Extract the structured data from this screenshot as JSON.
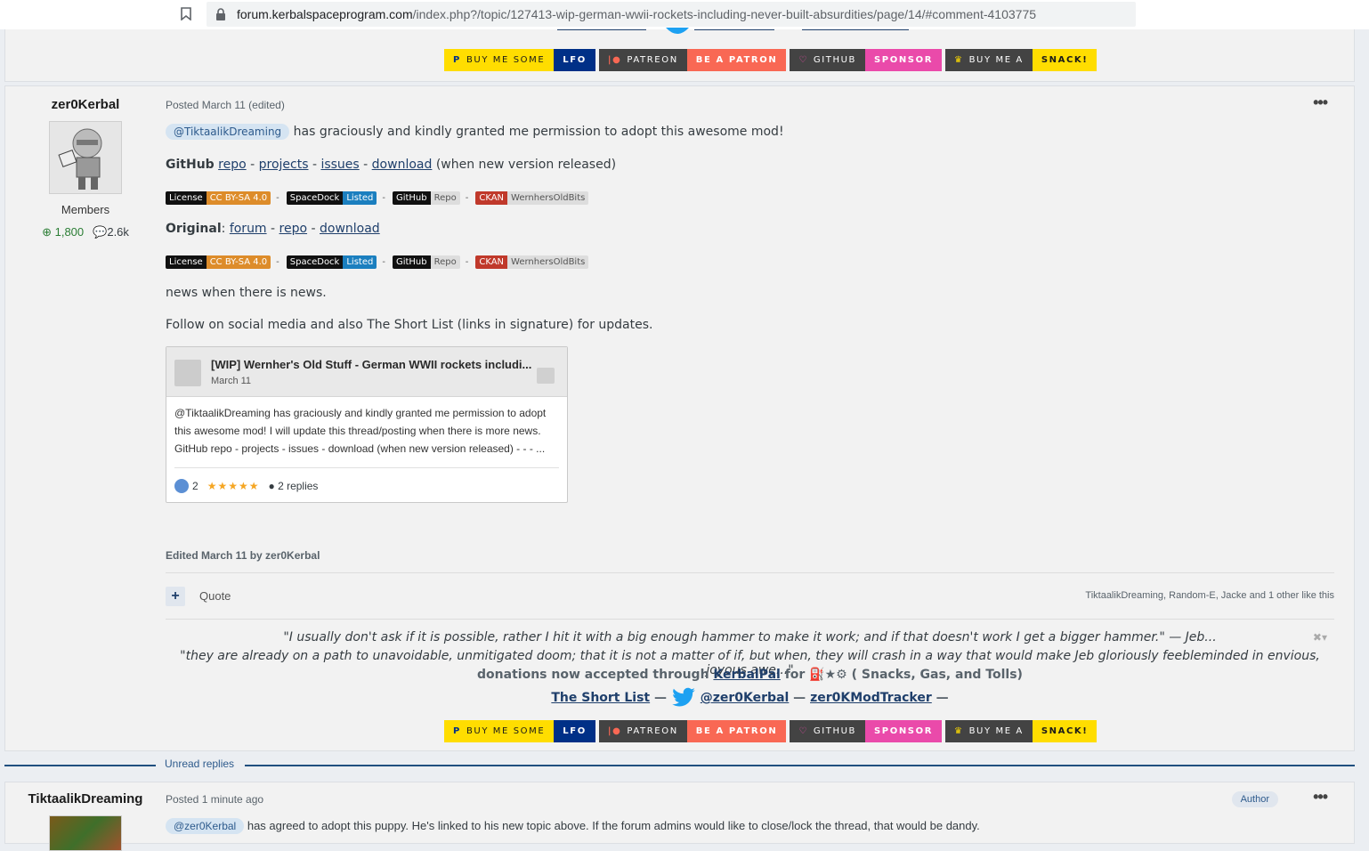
{
  "browser": {
    "url_domain": "forum.kerbalspaceprogram.com",
    "url_path": "/index.php?/topic/127413-wip-german-wwii-rockets-including-never-built-absurdities/page/14/#comment-4103775"
  },
  "donate": {
    "buy_me_some": "BUY ME SOME",
    "lfo": "LFO",
    "patreon": "PATREON",
    "be_a_patron": "BE A PATRON",
    "github": "GITHUB",
    "sponsor": "SPONSOR",
    "buy_me_a": "BUY ME A",
    "snack": "SNACK!"
  },
  "post1": {
    "author": "zer0Kerbal",
    "group": "Members",
    "reputation": "1,800",
    "posts": "2.6k",
    "meta": "Posted March 11 (edited)",
    "mention": "@TiktaalikDreaming",
    "intro": "has graciously and kindly granted me permission to adopt this awesome mod!",
    "github_label": "GitHub",
    "repo": "repo",
    "projects": "projects",
    "issues": "issues",
    "download": "download",
    "download_note": "(when new version released)",
    "original_label": "Original",
    "forum": "forum",
    "news": "news when there is news.",
    "follow": "Follow on social media and also The Short List (links in signature) for updates.",
    "edited": "Edited March 11 by zer0Kerbal",
    "quote": "Quote",
    "likes_text": "TiktaalikDreaming, Random-E, Jacke and 1 other like this"
  },
  "shields": {
    "license": "License",
    "license_val": "CC BY-SA 4.0",
    "spacedock": "SpaceDock",
    "listed": "Listed",
    "github": "GitHub",
    "repo": "Repo",
    "ckan": "CKAN",
    "ckan_val": "WernhersOldBits"
  },
  "embed": {
    "title": "[WIP] Wernher's Old Stuff - German WWII rockets includi...",
    "date": "March 11",
    "body1": "@TiktaalikDreaming has graciously and kindly granted me permission to adopt",
    "body2": "this awesome mod! I will update this thread/posting when there is more news.",
    "body3": "GitHub repo - projects - issues - download (when new version released) - - - ...",
    "reactions": "2",
    "replies": "2 replies"
  },
  "signature": {
    "quote1": "\"I usually don't ask if it is possible, rather I hit it with a big enough hammer to make it work; and if that doesn't work I get a bigger hammer.\"  — Jeb...",
    "quote2": "\"they are already on a path to unavoidable, unmitigated doom; that it is not a matter of if, but when, they will crash in a way that would make Jeb gloriously feebleminded in envious, joyous awe...\"",
    "donations_pre": "donations now accepted through",
    "kerbalpal": "KerbalPal",
    "donations_post": "for",
    "donations_tail": "( Snacks, Gas, and Tolls)",
    "short_list": "The Short List",
    "twitter": "@zer0Kerbal",
    "tracker": "zer0KModTracker"
  },
  "unread_label": "Unread replies",
  "post2": {
    "author": "TiktaalikDreaming",
    "meta": "Posted 1 minute ago",
    "badge": "Author",
    "mention": "@zer0Kerbal",
    "text": "has agreed to adopt this puppy.  He's linked to his new topic above.  If the forum admins would like to close/lock the thread, that would be dandy."
  },
  "colors": {
    "accent": "#1f3f6b",
    "paypal_yellow": "#ffdd00",
    "paypal_blue": "#003087",
    "patreon_red": "#f96854",
    "sponsor_pink": "#ea4aaa"
  }
}
